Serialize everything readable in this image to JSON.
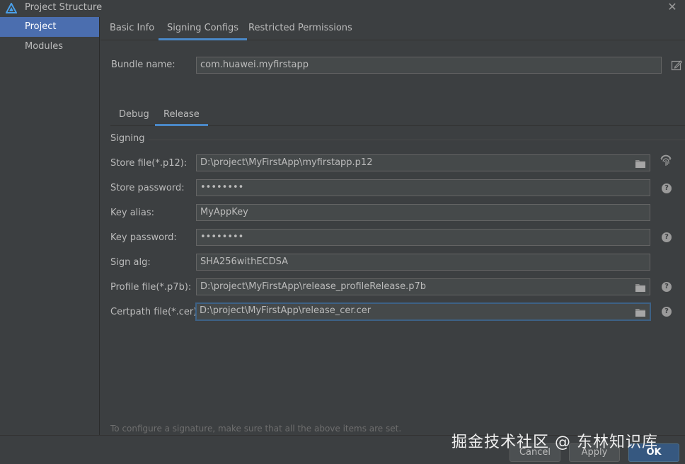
{
  "window": {
    "title": "Project Structure"
  },
  "sidebar": {
    "items": [
      {
        "label": "Project"
      },
      {
        "label": "Modules"
      }
    ]
  },
  "top_tabs": [
    {
      "label": "Basic Info"
    },
    {
      "label": "Signing Configs"
    },
    {
      "label": "Restricted Permissions"
    }
  ],
  "bundle": {
    "label": "Bundle name:",
    "value": "com.huawei.myfirstapp"
  },
  "sub_tabs": [
    {
      "label": "Debug"
    },
    {
      "label": "Release"
    }
  ],
  "signing": {
    "section_title": "Signing",
    "store_file": {
      "label": "Store file(*.p12):",
      "value": "D:\\project\\MyFirstApp\\myfirstapp.p12"
    },
    "store_password": {
      "label": "Store password:",
      "value": "••••••••"
    },
    "key_alias": {
      "label": "Key alias:",
      "value": "MyAppKey"
    },
    "key_password": {
      "label": "Key password:",
      "value": "••••••••"
    },
    "sign_alg": {
      "label": "Sign alg:",
      "value": "SHA256withECDSA"
    },
    "profile_file": {
      "label": "Profile file(*.p7b):",
      "value": "D:\\project\\MyFirstApp\\release_profileRelease.p7b"
    },
    "certpath_file": {
      "label": "Certpath file(*.cer):",
      "value": "D:\\project\\MyFirstApp\\release_cer.cer"
    }
  },
  "hint": "To configure a signature, make sure that all the above items are set.",
  "footer": {
    "cancel": "Cancel",
    "apply": "Apply",
    "ok": "OK"
  },
  "watermark": "掘金技术社区 @ 东林知识库",
  "icons": {
    "help": "?",
    "close": "✕"
  },
  "colors": {
    "accent": "#4a88c7",
    "selection": "#4b6eaf",
    "background": "#3c3f41"
  }
}
